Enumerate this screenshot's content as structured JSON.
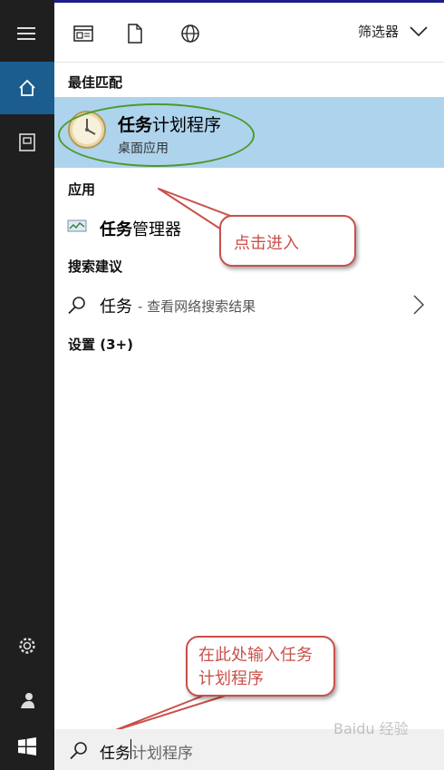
{
  "topbar": {
    "filter_label": "筛选器"
  },
  "best_match": {
    "heading": "最佳匹配",
    "app_name_bold": "任务",
    "app_name_rest": "计划程序",
    "app_type": "桌面应用"
  },
  "apps": {
    "heading": "应用",
    "item_bold": "任务",
    "item_rest": "管理器"
  },
  "suggestions": {
    "heading": "搜索建议",
    "query": "任务",
    "hint": "- 查看网络搜索结果"
  },
  "settings": {
    "heading": "设置 (3+)"
  },
  "annotations": {
    "callout_click": "点击进入",
    "callout_type": "在此处输入任务计划程序"
  },
  "search": {
    "typed": "任务",
    "suggestion_rest": "计划程序"
  },
  "watermark": "Baidu 经验",
  "colors": {
    "accent": "#1c5d8f",
    "selection": "#aed3ec",
    "callout_red": "#c9504a",
    "oval_green": "#4a9a2a"
  }
}
